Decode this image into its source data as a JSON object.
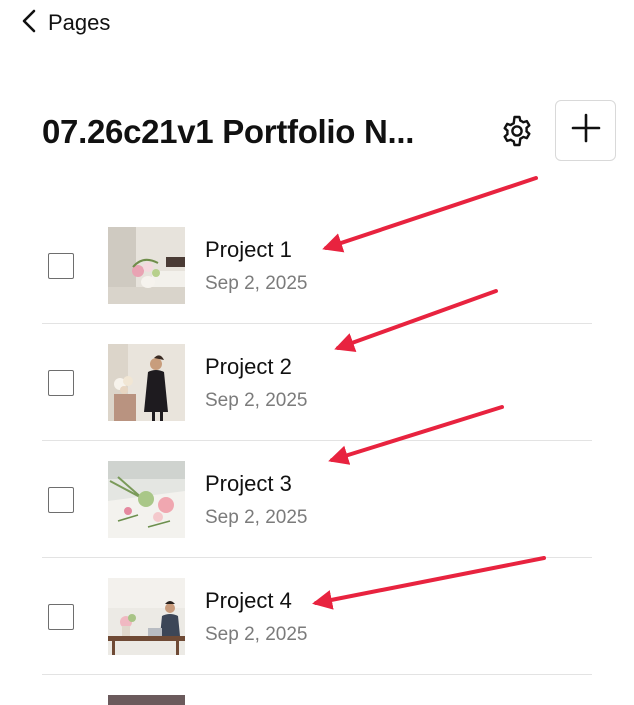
{
  "nav": {
    "back_label": "Pages"
  },
  "header": {
    "title": "07.26c21v1 Portfolio N...",
    "settings_icon": "gear-icon",
    "add_icon": "plus-icon"
  },
  "pages": [
    {
      "title": "Project 1",
      "date": "Sep 2, 2025",
      "checked": false
    },
    {
      "title": "Project 2",
      "date": "Sep 2, 2025",
      "checked": false
    },
    {
      "title": "Project 3",
      "date": "Sep 2, 2025",
      "checked": false
    },
    {
      "title": "Project 4",
      "date": "Sep 2, 2025",
      "checked": false
    }
  ],
  "annotation_color": "#e8233f"
}
